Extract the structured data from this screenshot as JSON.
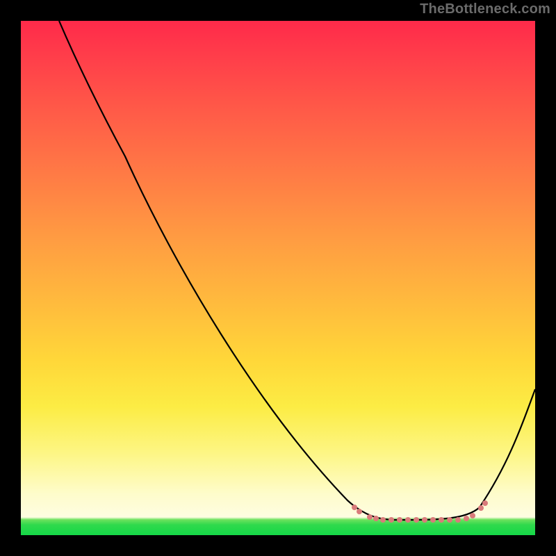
{
  "watermark": "TheBottleneck.com",
  "chart_data": {
    "type": "line",
    "title": "",
    "xlabel": "",
    "ylabel": "",
    "xlim": [
      0,
      100
    ],
    "ylim": [
      0,
      100
    ],
    "grid": false,
    "legend": false,
    "background": "vertical-gradient red→orange→yellow→cream→green",
    "series": [
      {
        "name": "bottleneck-curve",
        "style": "solid",
        "color": "#000000",
        "x": [
          7,
          12,
          18,
          25,
          33,
          42,
          52,
          60,
          65,
          70,
          75,
          80,
          84,
          87,
          90,
          94,
          98,
          100
        ],
        "values": [
          100,
          90,
          80,
          70,
          60,
          50,
          38,
          26,
          16,
          8,
          4,
          3,
          3,
          3,
          5,
          12,
          22,
          29
        ]
      },
      {
        "name": "valley-dots",
        "style": "dotted-markers",
        "color": "#d97b7b",
        "x": [
          65,
          66,
          68,
          69,
          70,
          72,
          74,
          75,
          77,
          79,
          80,
          82,
          83,
          85,
          87,
          88,
          89,
          90
        ],
        "values": [
          5,
          4,
          3.5,
          3.2,
          3,
          3,
          3,
          3,
          3,
          3,
          3,
          3,
          3,
          3.2,
          3.5,
          4,
          5,
          6
        ]
      }
    ],
    "annotations": []
  }
}
